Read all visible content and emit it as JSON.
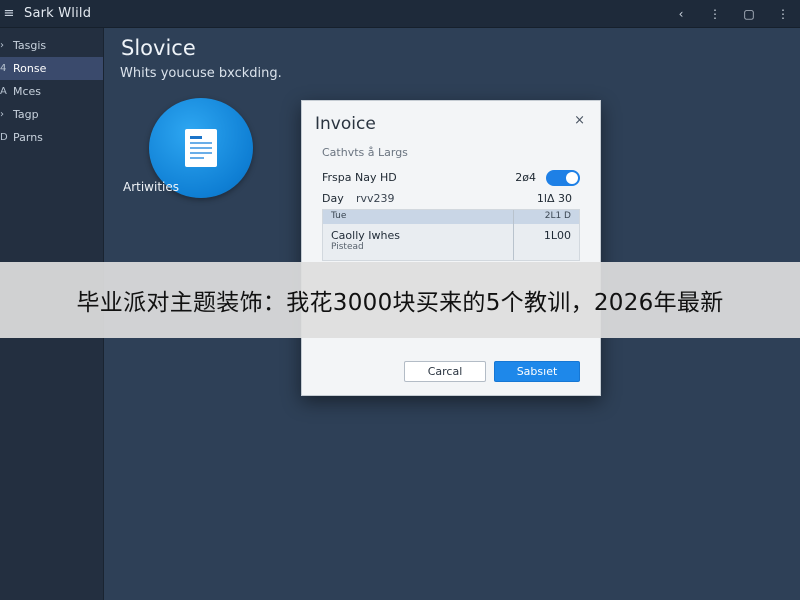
{
  "titlebar": {
    "title": "Sark Wlild",
    "menu_icon": "hamburger-icon",
    "buttons": [
      {
        "icon": "back-icon",
        "glyph": "‹"
      },
      {
        "icon": "more-icon",
        "glyph": "⋮"
      },
      {
        "icon": "restore-icon",
        "glyph": "▢"
      },
      {
        "icon": "menu-icon",
        "glyph": "⋮"
      }
    ]
  },
  "sidebar": {
    "items": [
      {
        "label": "Tasgis",
        "glyph": "›",
        "active": false
      },
      {
        "label": "Ronse",
        "glyph": "4",
        "active": true
      },
      {
        "label": "Mces",
        "glyph": "A",
        "active": false
      },
      {
        "label": "Tagp",
        "glyph": "›",
        "active": false
      },
      {
        "label": "Parns",
        "glyph": "D",
        "active": false
      }
    ]
  },
  "main": {
    "title": "Slovice",
    "subtitle": "Whits youcuse bxckding.",
    "tile_label": "Artiwities",
    "tile_icon": "document-icon"
  },
  "dialog": {
    "title": "Invoice",
    "close_glyph": "×",
    "subtitle": "Cathvts å Largs",
    "row1_label": "Frspa Nay HD",
    "row1_value": "2ø4",
    "row2_label": "Day",
    "row2_value": "rvv239",
    "row2_amount": "1lΔ 30",
    "table": {
      "head_left": "Tue",
      "head_right": "2L1 D",
      "item_name": "Caolly Iwhes",
      "item_note": "Pistead",
      "item_value": "1L00"
    },
    "cancel_label": "Carcal",
    "submit_label": "Sabsıet",
    "accent": "#1e88ea"
  },
  "banner": {
    "text": "毕业派对主题装饰：我花3000块买来的5个教训，2026年最新"
  }
}
